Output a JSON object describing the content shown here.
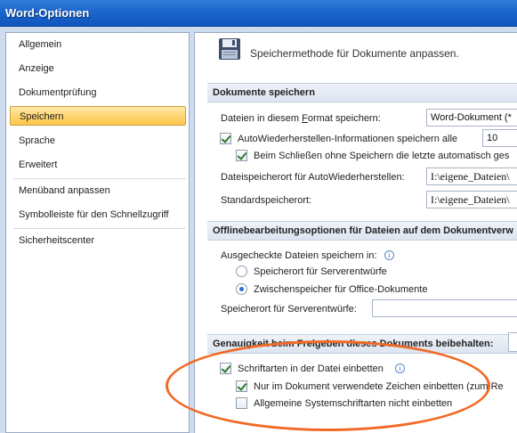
{
  "window": {
    "title": "Word-Optionen"
  },
  "sidebar": {
    "items": [
      {
        "label": "Allgemein"
      },
      {
        "label": "Anzeige"
      },
      {
        "label": "Dokumentprüfung"
      },
      {
        "label": "Speichern",
        "selected": true
      },
      {
        "label": "Sprache"
      },
      {
        "label": "Erweitert"
      },
      {
        "label": "Menüband anpassen"
      },
      {
        "label": "Symbolleiste für den Schnellzugriff"
      },
      {
        "label": "Sicherheitscenter"
      }
    ]
  },
  "main": {
    "header": {
      "icon": "floppy-disk-icon",
      "text": "Speichermethode für Dokumente anpassen."
    },
    "save_section": {
      "title": "Dokumente speichern",
      "format_label_pre": "Dateien in diesem ",
      "format_label_ul": "F",
      "format_label_post": "ormat speichern:",
      "format_value": "Word-Dokument (*",
      "autorecover_label": "AutoWiederherstellen-Informationen speichern alle",
      "autorecover_checked": true,
      "autorecover_minutes": "10",
      "keep_last_label": "Beim Schließen ohne Speichern die letzte automatisch ges",
      "keep_last_checked": true,
      "autorecover_location_label": "Dateispeicherort für AutoWiederherstellen:",
      "autorecover_location_value": "I:\\eigene_Dateien\\",
      "default_location_label": "Standardspeicherort:",
      "default_location_value": "I:\\eigene_Dateien\\"
    },
    "offline_section": {
      "title": "Offlinebearbeitungsoptionen für Dateien auf dem Dokumentverw",
      "checked_out_label": "Ausgecheckte Dateien speichern in:",
      "radio_server": "Speicherort für Serverentwürfe",
      "radio_server_selected": false,
      "radio_cache": "Zwischenspeicher für Office-Dokumente",
      "radio_cache_selected": true,
      "server_drafts_label": "Speicherort für Serverentwürfe:",
      "server_drafts_value": ""
    },
    "fidelity_section": {
      "title": "Genauigkeit beim Freigeben dieses Dokuments beibehalten:",
      "embed_fonts_label": "Schriftarten in der Datei einbetten",
      "embed_fonts_checked": true,
      "embed_used_only_label": "Nur im Dokument verwendete Zeichen einbetten (zum Re",
      "embed_used_only_checked": true,
      "no_common_fonts_label": "Allgemeine Systemschriftarten nicht einbetten",
      "no_common_fonts_checked": false
    }
  },
  "colors": {
    "titlebar": "#1c66cc",
    "selected_nav": "#ffd46f",
    "highlight_ellipse": "#f16a25"
  }
}
